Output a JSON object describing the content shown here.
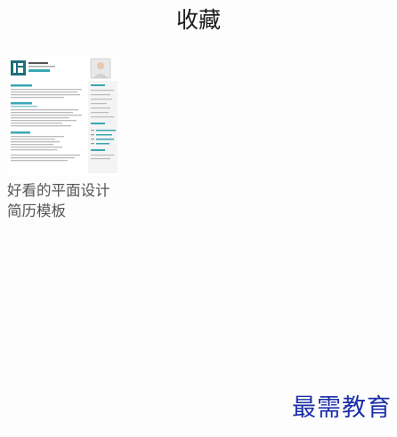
{
  "header": {
    "title": "收藏"
  },
  "favorites": [
    {
      "title": "好看的平面设计简历模板",
      "thumbnail_icon": "resume-template-thumbnail",
      "accent_color": "#3aa7b4"
    }
  ],
  "watermark": {
    "text": "最需教育"
  }
}
